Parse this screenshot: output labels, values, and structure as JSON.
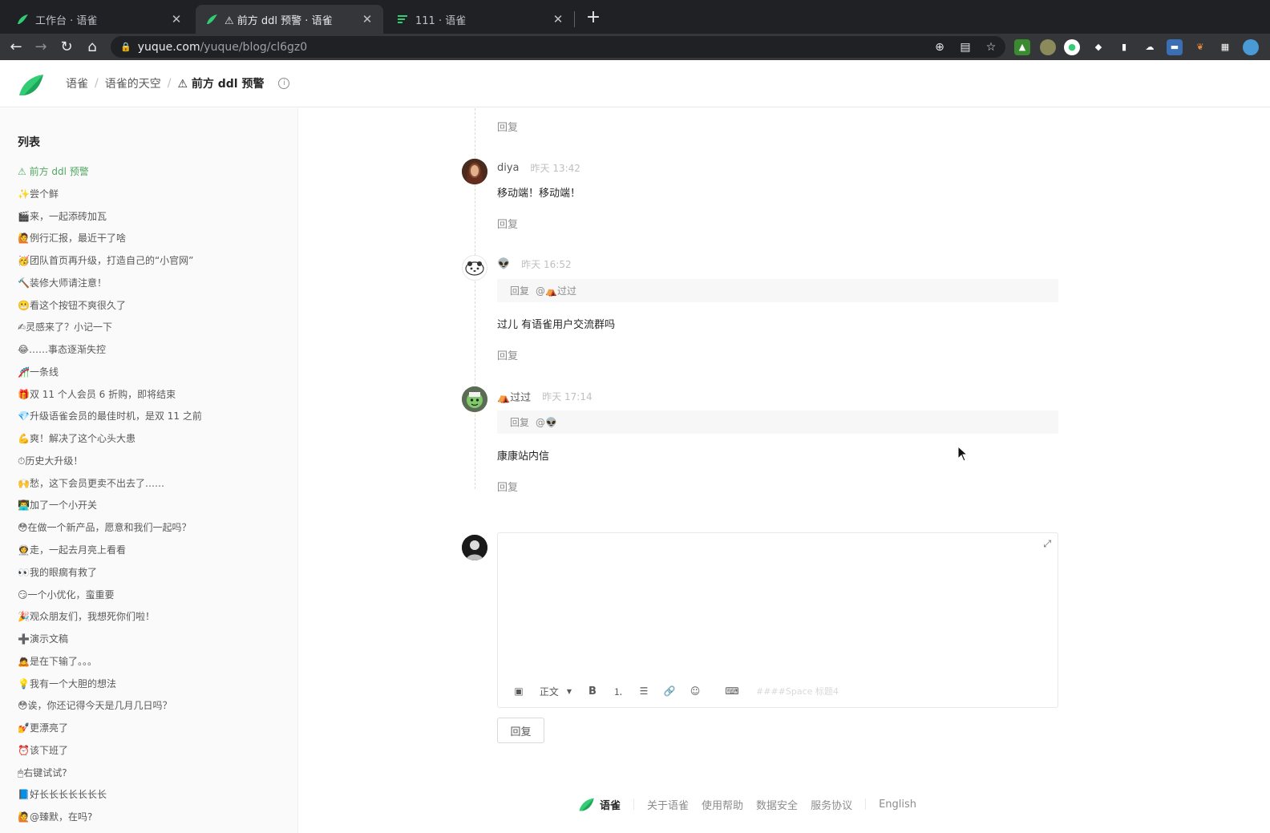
{
  "browser": {
    "tabs": [
      {
        "title": "工作台 · 语雀",
        "icon": "yuque-bird-icon",
        "active": false
      },
      {
        "title": "⚠ 前方 ddl 预警 · 语雀",
        "icon": "yuque-bird-icon",
        "active": true
      },
      {
        "title": "111 · 语雀",
        "icon": "yuque-doc-icon",
        "active": false
      }
    ],
    "url_host": "yuque.com",
    "url_path": "/yuque/blog/cl6gz0"
  },
  "header": {
    "crumbs": [
      "语雀",
      "语雀的天空"
    ],
    "current": "⚠ 前方 ddl 预警"
  },
  "sidebar": {
    "title": "列表",
    "items": [
      "⚠ 前方 ddl 预警",
      "✨尝个鲜",
      "🎬来，一起添砖加瓦",
      "🙋例行汇报，最近干了啥",
      "🥳团队首页再升级，打造自己的“小官网”",
      "🔨装修大师请注意！",
      "😬看这个按钮不爽很久了",
      "✍灵感来了？小记一下",
      "😂……事态逐渐失控",
      "🎢一条线",
      "🎁双 11 个人会员 6 折购，即将结束",
      "💎升级语雀会员的最佳时机，是双 11 之前",
      "💪爽！解决了这个心头大患",
      "⏱历史大升级！",
      "🙌愁，这下会员更卖不出去了……",
      "👨‍💻加了一个小开关",
      "😳在做一个新产品，愿意和我们一起吗？",
      "👩‍🚀走，一起去月亮上看看",
      "👀我的眼瘸有救了",
      "😏一个小优化，蛮重要",
      "🎉观众朋友们，我想死你们啦！",
      "➕演示文稿",
      "🙇是在下输了。。。",
      "💡我有一个大胆的想法",
      "😳诶，你还记得今天是几月几日吗？",
      "💅更漂亮了",
      "⏰该下班了",
      "🖱右键试试?",
      "📘好长长长长长长长",
      "🙋@臻默，在吗?"
    ]
  },
  "comments": {
    "top_reply": "回复",
    "list": [
      {
        "author": "diya",
        "time": "昨天 13:42",
        "quote": "",
        "quote_at": "",
        "body": "移动端！移动端！",
        "reply": "回复"
      },
      {
        "author": "👽",
        "time": "昨天 16:52",
        "quote": "回复",
        "quote_at": "@⛺过过",
        "body": "过儿 有语雀用户交流群吗",
        "reply": "回复"
      },
      {
        "author": "⛺过过",
        "time": "昨天 17:14",
        "quote": "回复",
        "quote_at": "@👽",
        "body": "康康站内信",
        "reply": "回复"
      }
    ]
  },
  "editor": {
    "style_label": "正文",
    "hint": "####Space 标题4",
    "submit": "回复"
  },
  "footer": {
    "brand": "语雀",
    "links": [
      "关于语雀",
      "使用帮助",
      "数据安全",
      "服务协议"
    ],
    "lang": "English"
  },
  "colors": {
    "brand_green": "#52a663",
    "chrome_dark": "#202124"
  }
}
